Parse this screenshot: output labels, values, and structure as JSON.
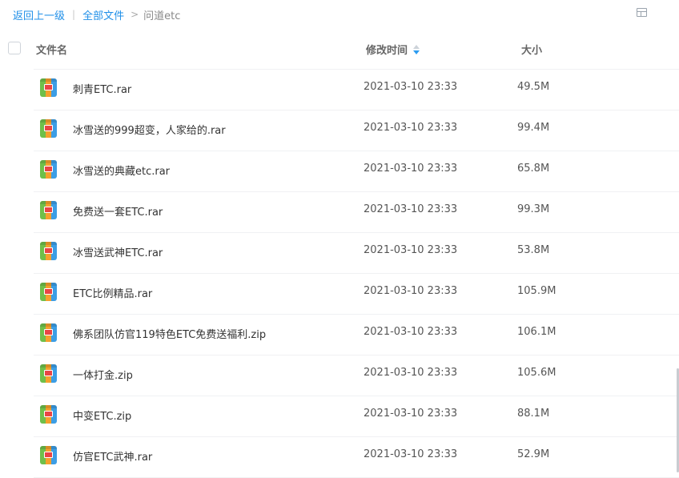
{
  "breadcrumb": {
    "back": "返回上一级",
    "separator": "|",
    "all_files": "全部文件",
    "arrow": ">",
    "current": "问道etc"
  },
  "header": {
    "name": "文件名",
    "time": "修改时间",
    "size": "大小"
  },
  "files": [
    {
      "name": "刺青ETC.rar",
      "time": "2021-03-10 23:33",
      "size": "49.5M"
    },
    {
      "name": "冰雪送的999超变，人家给的.rar",
      "time": "2021-03-10 23:33",
      "size": "99.4M"
    },
    {
      "name": "冰雪送的典藏etc.rar",
      "time": "2021-03-10 23:33",
      "size": "65.8M"
    },
    {
      "name": "免费送一套ETC.rar",
      "time": "2021-03-10 23:33",
      "size": "99.3M"
    },
    {
      "name": "冰雪送武神ETC.rar",
      "time": "2021-03-10 23:33",
      "size": "53.8M"
    },
    {
      "name": "ETC比例精品.rar",
      "time": "2021-03-10 23:33",
      "size": "105.9M"
    },
    {
      "name": "佛系团队仿官119特色ETC免费送福利.zip",
      "time": "2021-03-10 23:33",
      "size": "106.1M"
    },
    {
      "name": "一体打金.zip",
      "time": "2021-03-10 23:33",
      "size": "105.6M"
    },
    {
      "name": "中变ETC.zip",
      "time": "2021-03-10 23:33",
      "size": "88.1M"
    },
    {
      "name": "仿官ETC武神.rar",
      "time": "2021-03-10 23:33",
      "size": "52.9M"
    }
  ],
  "icons": {
    "file": "archive-file-icon",
    "view": "grid-view-icon",
    "sort": "sort-desc-icon"
  },
  "colors": {
    "link": "#1f8fe8",
    "sort_active": "#2c9cf0"
  }
}
